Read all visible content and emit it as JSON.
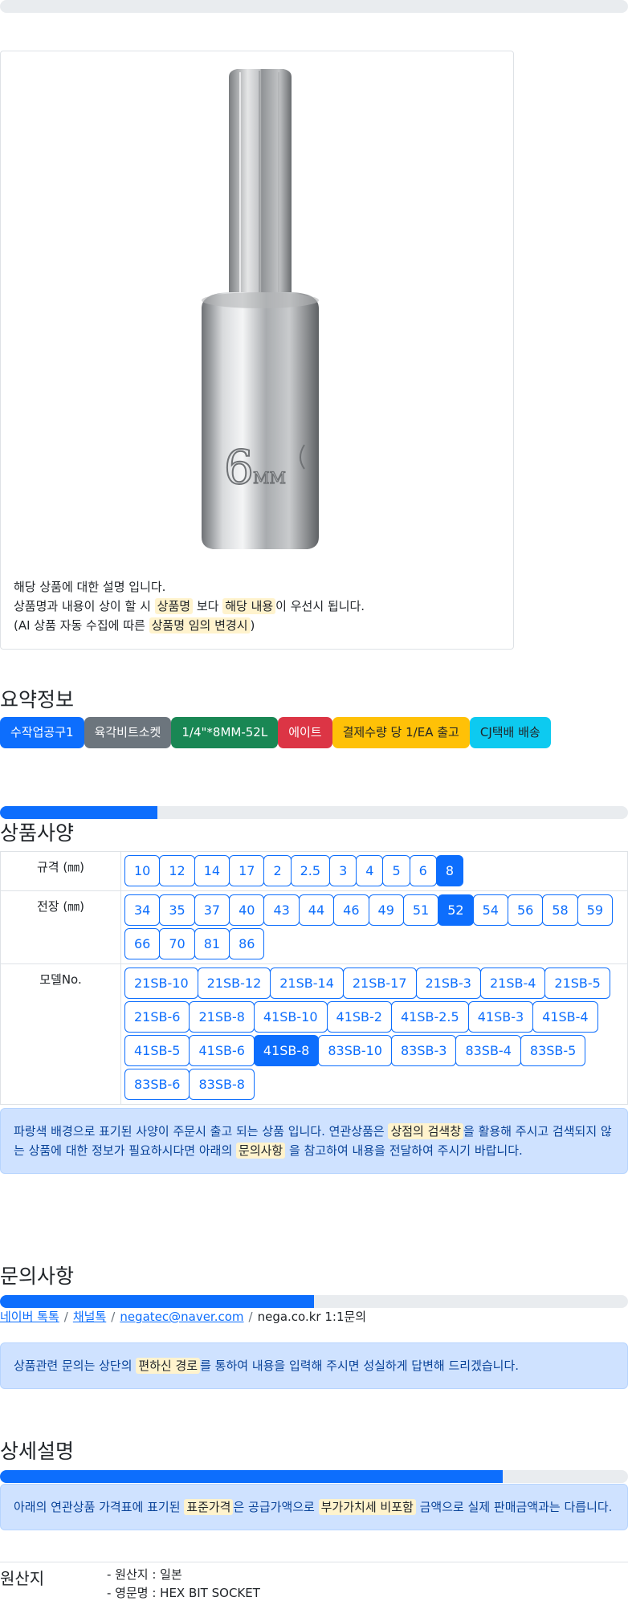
{
  "top_progress": {
    "percent": 0
  },
  "description": {
    "line1": "해당 상품에 대한 설명 입니다.",
    "line2_a": "상품명과 내용이 상이 할 시 ",
    "line2_hl1": "상품명",
    "line2_b": " 보다 ",
    "line2_hl2": "해당 내용",
    "line2_c": "이 우선시 됩니다.",
    "line3_a": "(AI 상품 자동 수집에 따른 ",
    "line3_hl": "상품명 임의 변경시",
    "line3_b": ")"
  },
  "product_image": {
    "marking_number": "6",
    "marking_unit": "MM"
  },
  "summary": {
    "title": "요약정보",
    "badges": [
      {
        "label": "수작업공구1",
        "color": "#0d6efd"
      },
      {
        "label": "육각비트소켓",
        "color": "#6c757d"
      },
      {
        "label": "1/4\"*8MM-52L",
        "color": "#198754"
      },
      {
        "label": "에이트",
        "color": "#dc3545"
      },
      {
        "label": "결제수량 당 1/EA 출고",
        "color": "#ffc107"
      },
      {
        "label": "CJ택배 배송",
        "color": "#0dcaf0"
      }
    ]
  },
  "spec": {
    "progress_percent": 25,
    "title": "상품사양",
    "rows": [
      {
        "label": "규격 (㎜)",
        "options": [
          "10",
          "12",
          "14",
          "17",
          "2",
          "2.5",
          "3",
          "4",
          "5",
          "6",
          "8"
        ],
        "active": "8"
      },
      {
        "label": "전장 (㎜)",
        "options": [
          "34",
          "35",
          "37",
          "40",
          "43",
          "44",
          "46",
          "49",
          "51",
          "52",
          "54",
          "56",
          "58",
          "59",
          "66",
          "70",
          "81",
          "86"
        ],
        "active": "52"
      },
      {
        "label": "모델No.",
        "options": [
          "21SB-10",
          "21SB-12",
          "21SB-14",
          "21SB-17",
          "21SB-3",
          "21SB-4",
          "21SB-5",
          "21SB-6",
          "21SB-8",
          "41SB-10",
          "41SB-2",
          "41SB-2.5",
          "41SB-3",
          "41SB-4",
          "41SB-5",
          "41SB-6",
          "41SB-8",
          "83SB-10",
          "83SB-3",
          "83SB-4",
          "83SB-5",
          "83SB-6",
          "83SB-8"
        ],
        "active": "41SB-8"
      }
    ],
    "notice_a": "파랑색 배경으로 표기된 사양이 주문시 출고 되는 상품 입니다. 연관상품은 ",
    "notice_hl1": "상점의 검색창",
    "notice_b": "을 활용해 주시고 검색되지 않는 상품에 대한 정보가 필요하시다면 아래의 ",
    "notice_hl2": "문의사항",
    "notice_c": " 을 참고하여 내용을 전달하여 주시기 바랍니다."
  },
  "inquiry": {
    "title": "문의사항",
    "progress_percent": 50,
    "links": [
      "네이버 톡톡",
      "채널톡",
      "negatec@naver.com"
    ],
    "plain": "nega.co.kr 1:1문의",
    "separator": "/",
    "notice_a": "상품관련 문의는 상단의 ",
    "notice_hl": "편하신 경로",
    "notice_b": "를 통하여 내용을 입력해 주시면 성실하게 답변해 드리겠습니다."
  },
  "detail": {
    "title": "상세설명",
    "progress_percent": 80,
    "notice_a": "아래의 연관상품 가격표에 표기된 ",
    "notice_hl1": "표준가격",
    "notice_b": "은 공급가액으로 ",
    "notice_hl2": "부가가치세 비포함",
    "notice_c": " 금액으로 실제 판매금액과는 다릅니다."
  },
  "origin": {
    "label": "원산지",
    "line1": "- 원산지 : 일본",
    "line2": "- 영문명 : HEX BIT SOCKET"
  }
}
